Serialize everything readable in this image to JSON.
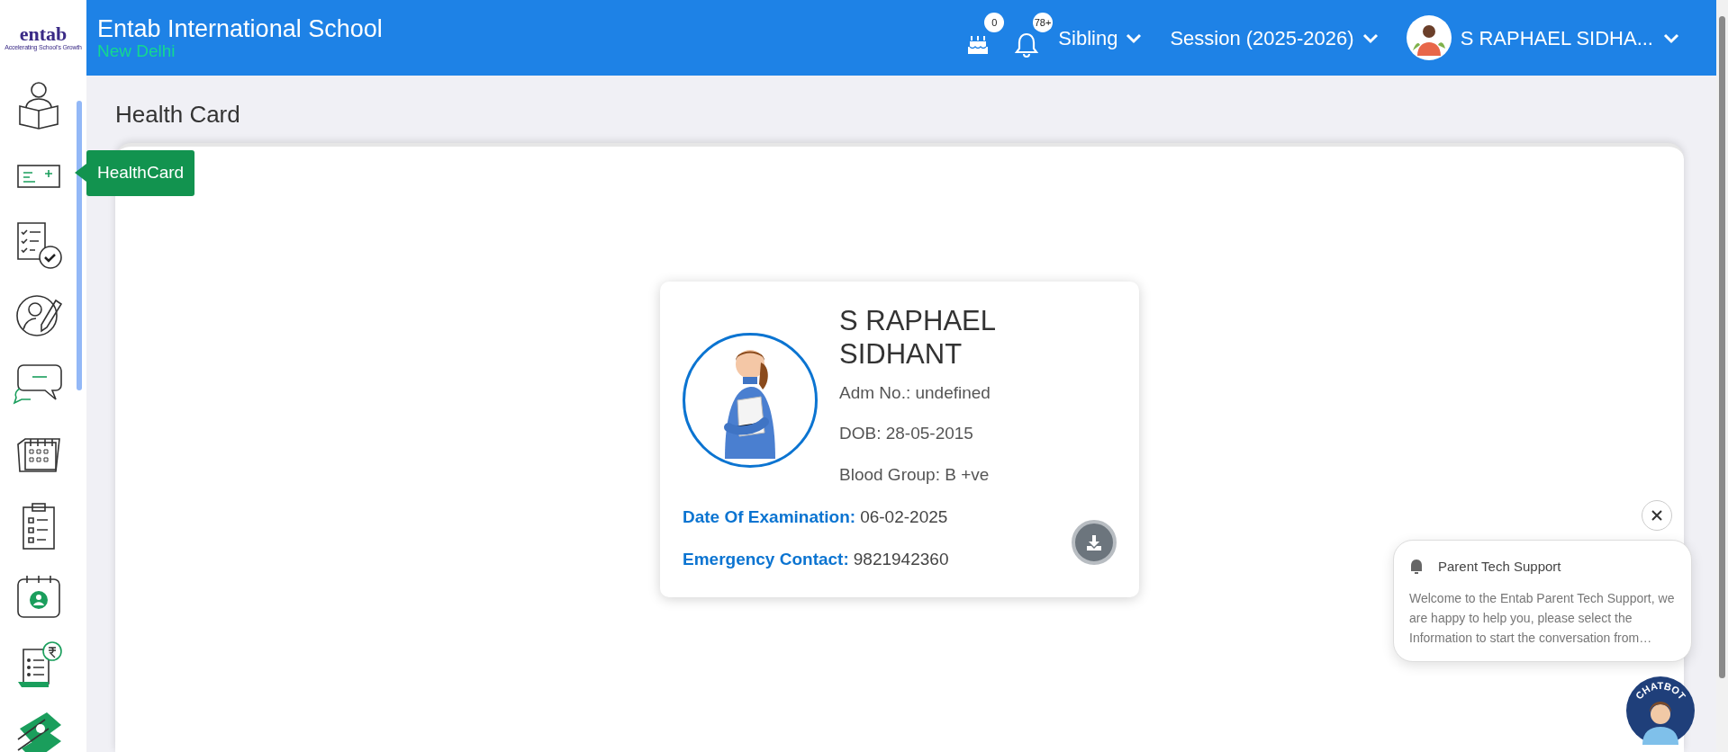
{
  "logo": {
    "name": "entab",
    "tagline": "Accelerating School's Growth"
  },
  "header": {
    "school": "Entab International School",
    "location": "New Delhi",
    "badges": [
      {
        "kind": "cake",
        "count": "0"
      },
      {
        "kind": "bell",
        "count": "78+"
      }
    ],
    "menus": [
      {
        "kind": "text",
        "label": "Sibling"
      },
      {
        "kind": "text",
        "label": "Session (2025-2026)"
      },
      {
        "kind": "user",
        "label": "S RAPHAEL SIDHA..."
      }
    ]
  },
  "sidebar": {
    "items": [
      {
        "kind": "reader"
      },
      {
        "kind": "card",
        "tooltip": "HealthCard"
      },
      {
        "kind": "checklist"
      },
      {
        "kind": "profile"
      },
      {
        "kind": "chat"
      },
      {
        "kind": "calendar"
      },
      {
        "kind": "clipboard"
      },
      {
        "kind": "attendance"
      },
      {
        "kind": "fee"
      },
      {
        "kind": "money"
      }
    ]
  },
  "page_title": "Health Card",
  "student": {
    "name": "S RAPHAEL SIDHANT",
    "details": [
      "Adm No.: undefined",
      "DOB: 28-05-2015",
      "Blood Group: B +ve"
    ],
    "fields": [
      {
        "label": "Date Of Examination:",
        "value": "06-02-2025"
      },
      {
        "label": "Emergency Contact:",
        "value": "9821942360"
      }
    ]
  },
  "chat": {
    "title": "Parent Tech Support",
    "message": "Welcome to the Entab Parent Tech Support, we are happy to help you, please select the Information to start the conversation from…",
    "badge": "CHATBOT"
  }
}
